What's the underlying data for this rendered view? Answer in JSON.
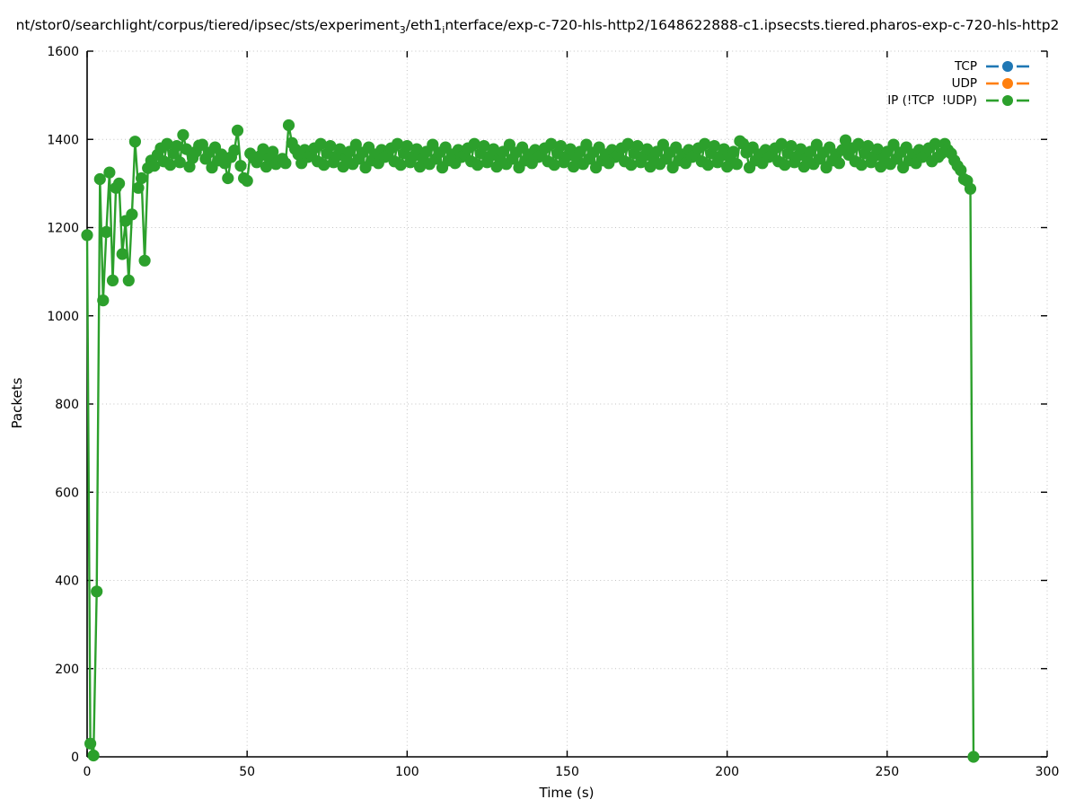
{
  "title": {
    "segments": [
      {
        "text": "nt/stor0/searchlight/corpus/tiered/ipsec/sts/experiment",
        "sub": false
      },
      {
        "text": "3",
        "sub": true
      },
      {
        "text": "/eth1",
        "sub": false
      },
      {
        "text": "i",
        "sub": true
      },
      {
        "text": "nterface/exp-c-720-hls-http2/1648622888-c1.ipsecsts.tiered.pharos-exp-c-720-hls-http2",
        "sub": false
      }
    ]
  },
  "chart_data": {
    "type": "line",
    "title_note": "packet counts per second per protocol",
    "xlabel": "Time (s)",
    "ylabel": "Packets",
    "xlim": [
      0,
      300
    ],
    "ylim": [
      0,
      1600
    ],
    "xticks": [
      0,
      50,
      100,
      150,
      200,
      250,
      300
    ],
    "yticks": [
      0,
      200,
      400,
      600,
      800,
      1000,
      1200,
      1400,
      1600
    ],
    "grid": "dotted",
    "grid_color": "#c3c3c3",
    "axis_color": "#000000",
    "legend_position": "top-right-inside",
    "marker": "filled-circle",
    "series": [
      {
        "name": "TCP",
        "color": "#1f77b4",
        "points": []
      },
      {
        "name": "UDP",
        "color": "#ff7f0e",
        "points": []
      },
      {
        "name": "IP (!TCP  !UDP)",
        "color": "#2ca02c",
        "points": [
          [
            0,
            1183
          ],
          [
            1,
            30
          ],
          [
            2,
            3
          ],
          [
            3,
            375
          ],
          [
            4,
            1310
          ],
          [
            5,
            1035
          ],
          [
            6,
            1190
          ],
          [
            7,
            1325
          ],
          [
            8,
            1080
          ],
          [
            9,
            1290
          ],
          [
            10,
            1300
          ],
          [
            11,
            1140
          ],
          [
            12,
            1215
          ],
          [
            13,
            1080
          ],
          [
            14,
            1230
          ],
          [
            15,
            1395
          ],
          [
            16,
            1290
          ],
          [
            17,
            1312
          ],
          [
            18,
            1125
          ],
          [
            19,
            1335
          ],
          [
            20,
            1352
          ],
          [
            21,
            1340
          ],
          [
            22,
            1365
          ],
          [
            23,
            1380
          ],
          [
            24,
            1350
          ],
          [
            25,
            1390
          ],
          [
            26,
            1342
          ],
          [
            27,
            1368
          ],
          [
            28,
            1385
          ],
          [
            29,
            1348
          ],
          [
            30,
            1410
          ],
          [
            31,
            1378
          ],
          [
            32,
            1338
          ],
          [
            33,
            1358
          ],
          [
            34,
            1372
          ],
          [
            35,
            1386
          ],
          [
            36,
            1388
          ],
          [
            37,
            1356
          ],
          [
            38,
            1370
          ],
          [
            39,
            1336
          ],
          [
            40,
            1382
          ],
          [
            41,
            1352
          ],
          [
            42,
            1366
          ],
          [
            43,
            1346
          ],
          [
            44,
            1312
          ],
          [
            45,
            1360
          ],
          [
            46,
            1375
          ],
          [
            47,
            1420
          ],
          [
            48,
            1340
          ],
          [
            49,
            1312
          ],
          [
            50,
            1306
          ],
          [
            51,
            1368
          ],
          [
            52,
            1358
          ],
          [
            53,
            1348
          ],
          [
            54,
            1362
          ],
          [
            55,
            1378
          ],
          [
            56,
            1338
          ],
          [
            57,
            1358
          ],
          [
            58,
            1372
          ],
          [
            59,
            1344
          ],
          [
            60,
            1352
          ],
          [
            61,
            1356
          ],
          [
            62,
            1346
          ],
          [
            63,
            1432
          ],
          [
            64,
            1392
          ],
          [
            65,
            1378
          ],
          [
            66,
            1366
          ],
          [
            67,
            1346
          ],
          [
            68,
            1376
          ],
          [
            69,
            1360
          ],
          [
            70,
            1365
          ],
          [
            71,
            1380
          ],
          [
            72,
            1350
          ],
          [
            73,
            1390
          ],
          [
            74,
            1342
          ],
          [
            75,
            1368
          ],
          [
            76,
            1385
          ],
          [
            77,
            1348
          ],
          [
            78,
            1362
          ],
          [
            79,
            1378
          ],
          [
            80,
            1338
          ],
          [
            81,
            1358
          ],
          [
            82,
            1372
          ],
          [
            83,
            1344
          ],
          [
            84,
            1388
          ],
          [
            85,
            1356
          ],
          [
            86,
            1370
          ],
          [
            87,
            1336
          ],
          [
            88,
            1382
          ],
          [
            89,
            1352
          ],
          [
            90,
            1366
          ],
          [
            91,
            1346
          ],
          [
            92,
            1376
          ],
          [
            93,
            1360
          ],
          [
            94,
            1365
          ],
          [
            95,
            1380
          ],
          [
            96,
            1350
          ],
          [
            97,
            1390
          ],
          [
            98,
            1342
          ],
          [
            99,
            1368
          ],
          [
            100,
            1385
          ],
          [
            101,
            1348
          ],
          [
            102,
            1362
          ],
          [
            103,
            1378
          ],
          [
            104,
            1338
          ],
          [
            105,
            1358
          ],
          [
            106,
            1372
          ],
          [
            107,
            1344
          ],
          [
            108,
            1388
          ],
          [
            109,
            1356
          ],
          [
            110,
            1370
          ],
          [
            111,
            1336
          ],
          [
            112,
            1382
          ],
          [
            113,
            1352
          ],
          [
            114,
            1366
          ],
          [
            115,
            1346
          ],
          [
            116,
            1376
          ],
          [
            117,
            1360
          ],
          [
            118,
            1365
          ],
          [
            119,
            1380
          ],
          [
            120,
            1350
          ],
          [
            121,
            1390
          ],
          [
            122,
            1342
          ],
          [
            123,
            1368
          ],
          [
            124,
            1385
          ],
          [
            125,
            1348
          ],
          [
            126,
            1362
          ],
          [
            127,
            1378
          ],
          [
            128,
            1338
          ],
          [
            129,
            1358
          ],
          [
            130,
            1372
          ],
          [
            131,
            1344
          ],
          [
            132,
            1388
          ],
          [
            133,
            1356
          ],
          [
            134,
            1370
          ],
          [
            135,
            1336
          ],
          [
            136,
            1382
          ],
          [
            137,
            1352
          ],
          [
            138,
            1366
          ],
          [
            139,
            1346
          ],
          [
            140,
            1376
          ],
          [
            141,
            1360
          ],
          [
            142,
            1365
          ],
          [
            143,
            1380
          ],
          [
            144,
            1350
          ],
          [
            145,
            1390
          ],
          [
            146,
            1342
          ],
          [
            147,
            1368
          ],
          [
            148,
            1385
          ],
          [
            149,
            1348
          ],
          [
            150,
            1362
          ],
          [
            151,
            1378
          ],
          [
            152,
            1338
          ],
          [
            153,
            1358
          ],
          [
            154,
            1372
          ],
          [
            155,
            1344
          ],
          [
            156,
            1388
          ],
          [
            157,
            1356
          ],
          [
            158,
            1370
          ],
          [
            159,
            1336
          ],
          [
            160,
            1382
          ],
          [
            161,
            1352
          ],
          [
            162,
            1366
          ],
          [
            163,
            1346
          ],
          [
            164,
            1376
          ],
          [
            165,
            1360
          ],
          [
            166,
            1365
          ],
          [
            167,
            1380
          ],
          [
            168,
            1350
          ],
          [
            169,
            1390
          ],
          [
            170,
            1342
          ],
          [
            171,
            1368
          ],
          [
            172,
            1385
          ],
          [
            173,
            1348
          ],
          [
            174,
            1362
          ],
          [
            175,
            1378
          ],
          [
            176,
            1338
          ],
          [
            177,
            1358
          ],
          [
            178,
            1372
          ],
          [
            179,
            1344
          ],
          [
            180,
            1388
          ],
          [
            181,
            1356
          ],
          [
            182,
            1370
          ],
          [
            183,
            1336
          ],
          [
            184,
            1382
          ],
          [
            185,
            1352
          ],
          [
            186,
            1366
          ],
          [
            187,
            1346
          ],
          [
            188,
            1376
          ],
          [
            189,
            1360
          ],
          [
            190,
            1365
          ],
          [
            191,
            1380
          ],
          [
            192,
            1350
          ],
          [
            193,
            1390
          ],
          [
            194,
            1342
          ],
          [
            195,
            1368
          ],
          [
            196,
            1385
          ],
          [
            197,
            1348
          ],
          [
            198,
            1362
          ],
          [
            199,
            1378
          ],
          [
            200,
            1338
          ],
          [
            201,
            1358
          ],
          [
            202,
            1372
          ],
          [
            203,
            1344
          ],
          [
            204,
            1396
          ],
          [
            205,
            1390
          ],
          [
            206,
            1370
          ],
          [
            207,
            1336
          ],
          [
            208,
            1382
          ],
          [
            209,
            1352
          ],
          [
            210,
            1366
          ],
          [
            211,
            1346
          ],
          [
            212,
            1376
          ],
          [
            213,
            1360
          ],
          [
            214,
            1365
          ],
          [
            215,
            1380
          ],
          [
            216,
            1350
          ],
          [
            217,
            1390
          ],
          [
            218,
            1342
          ],
          [
            219,
            1368
          ],
          [
            220,
            1385
          ],
          [
            221,
            1348
          ],
          [
            222,
            1362
          ],
          [
            223,
            1378
          ],
          [
            224,
            1338
          ],
          [
            225,
            1358
          ],
          [
            226,
            1372
          ],
          [
            227,
            1344
          ],
          [
            228,
            1388
          ],
          [
            229,
            1356
          ],
          [
            230,
            1370
          ],
          [
            231,
            1336
          ],
          [
            232,
            1382
          ],
          [
            233,
            1352
          ],
          [
            234,
            1366
          ],
          [
            235,
            1346
          ],
          [
            236,
            1376
          ],
          [
            237,
            1398
          ],
          [
            238,
            1365
          ],
          [
            239,
            1380
          ],
          [
            240,
            1350
          ],
          [
            241,
            1390
          ],
          [
            242,
            1342
          ],
          [
            243,
            1368
          ],
          [
            244,
            1385
          ],
          [
            245,
            1348
          ],
          [
            246,
            1362
          ],
          [
            247,
            1378
          ],
          [
            248,
            1338
          ],
          [
            249,
            1358
          ],
          [
            250,
            1372
          ],
          [
            251,
            1344
          ],
          [
            252,
            1388
          ],
          [
            253,
            1356
          ],
          [
            254,
            1370
          ],
          [
            255,
            1336
          ],
          [
            256,
            1382
          ],
          [
            257,
            1352
          ],
          [
            258,
            1366
          ],
          [
            259,
            1346
          ],
          [
            260,
            1376
          ],
          [
            261,
            1360
          ],
          [
            262,
            1365
          ],
          [
            263,
            1380
          ],
          [
            264,
            1350
          ],
          [
            265,
            1390
          ],
          [
            266,
            1360
          ],
          [
            267,
            1368
          ],
          [
            268,
            1390
          ],
          [
            269,
            1376
          ],
          [
            270,
            1368
          ],
          [
            271,
            1352
          ],
          [
            272,
            1340
          ],
          [
            273,
            1330
          ],
          [
            274,
            1310
          ],
          [
            275,
            1306
          ],
          [
            276,
            1288
          ],
          [
            277,
            0
          ]
        ]
      }
    ]
  }
}
